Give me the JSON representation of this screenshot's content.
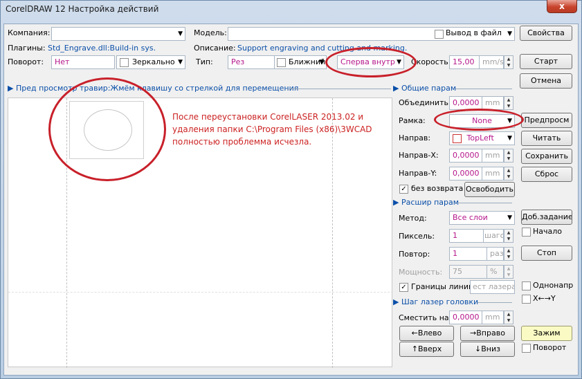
{
  "window": {
    "title": "CorelDRAW 12 Настройка действий",
    "close": "x"
  },
  "top": {
    "company_label": "Компания:",
    "company_value": "",
    "model_label": "Модель:",
    "model_value": "",
    "output_to_file": "Вывод в файл",
    "plugins_label": "Плагины:",
    "plugins_value": "Std_Engrave.dll:Build-in sys.",
    "description_label": "Описание:",
    "description_value": "Support engraving and cutting and marking.",
    "rotate_label": "Поворот:",
    "rotate_value": "Нет",
    "mirror": "Зеркально",
    "type_label": "Тип:",
    "type_value": "Рез",
    "nearest": "Ближний",
    "order_value": "Сперва внутр",
    "speed_label": "Скорость:",
    "speed_value": "15,00",
    "speed_unit": "mm/s"
  },
  "buttons": {
    "properties": "Свойства",
    "start": "Старт",
    "cancel": "Отмена",
    "preview": "Предпросм",
    "read": "Читать",
    "save": "Сохранить",
    "reset": "Сброс",
    "add_task": "Доб.задание",
    "stop": "Стоп",
    "release": "Освободить",
    "clamp": "Зажим",
    "left": "←Влево",
    "right": "→Вправо",
    "up": "↑Вверх",
    "down": "↓Вниз"
  },
  "preview": {
    "header": "Пред просмотр травир:Жмём клавишу со стрелкой для перемещения",
    "note": "После переустановки CorelLASER 2013.02 и удаления папки C:\\Program Files (x86)\\3WCAD полностью проблемма исчезла."
  },
  "general": {
    "title": "Общие парам",
    "merge_label": "Объединить:",
    "merge_value": "0,0000",
    "merge_unit": "mm",
    "frame_label": "Рамка:",
    "frame_value": "None",
    "dir_label": "Направ:",
    "dir_value": "TopLeft",
    "dirx_label": "Направ-X:",
    "dirx_value": "0,0000",
    "dirx_unit": "mm",
    "diry_label": "Направ-Y:",
    "diry_value": "0,0000",
    "diry_unit": "mm",
    "no_return": "без возврата"
  },
  "extended": {
    "title": "Расшир парам",
    "method_label": "Метод:",
    "method_value": "Все слои",
    "pixel_label": "Пиксель:",
    "pixel_value": "1",
    "pixel_unit": "шагов",
    "repeat_label": "Повтор:",
    "repeat_value": "1",
    "repeat_unit": "раз",
    "power_label": "Мощность:",
    "power_value": "75",
    "power_unit": "%",
    "borders": "Границы линии",
    "borders_field": "ест лазера",
    "start_check": "Начало",
    "one_dir": "Однонапр",
    "xy": "X←→Y"
  },
  "step": {
    "title": "Шаг лазер головки",
    "shift_label": "Сместить на:",
    "shift_value": "0,0000",
    "shift_unit": "mm",
    "rotate": "Поворот"
  },
  "colors": {
    "annotation": "#c8202a",
    "accent": "#0b4fa8",
    "value": "#b5158a"
  }
}
